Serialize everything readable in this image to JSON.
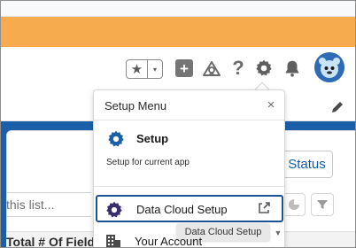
{
  "header": {
    "favorites_star": "★",
    "favorites_caret": "▾",
    "add_symbol": "+",
    "help_symbol": "?",
    "icons": [
      "favorites-star-icon",
      "plus-icon",
      "trailhead-icon",
      "help-icon",
      "gear-icon",
      "bell-icon",
      "avatar"
    ]
  },
  "page": {
    "status_button": "Status",
    "search_placeholder": "this list...",
    "column_header": "Total # Of Fields"
  },
  "setup_menu": {
    "title": "Setup Menu",
    "close_symbol": "×",
    "items": [
      {
        "label": "Setup",
        "sublabel": "Setup for current app",
        "icon": "gear-icon"
      },
      {
        "label": "Data Cloud Setup",
        "icon": "data-cloud-gear-icon",
        "trailing_icon": "external-link-icon"
      },
      {
        "label": "Your Account",
        "icon": "building-icon"
      }
    ],
    "tooltip": "Data Cloud Setup"
  },
  "colors": {
    "orange_band": "#f5ab4e",
    "brand_blue": "#1b5fa8",
    "selection_border": "#1b5296",
    "link_blue": "#0b5cab"
  }
}
